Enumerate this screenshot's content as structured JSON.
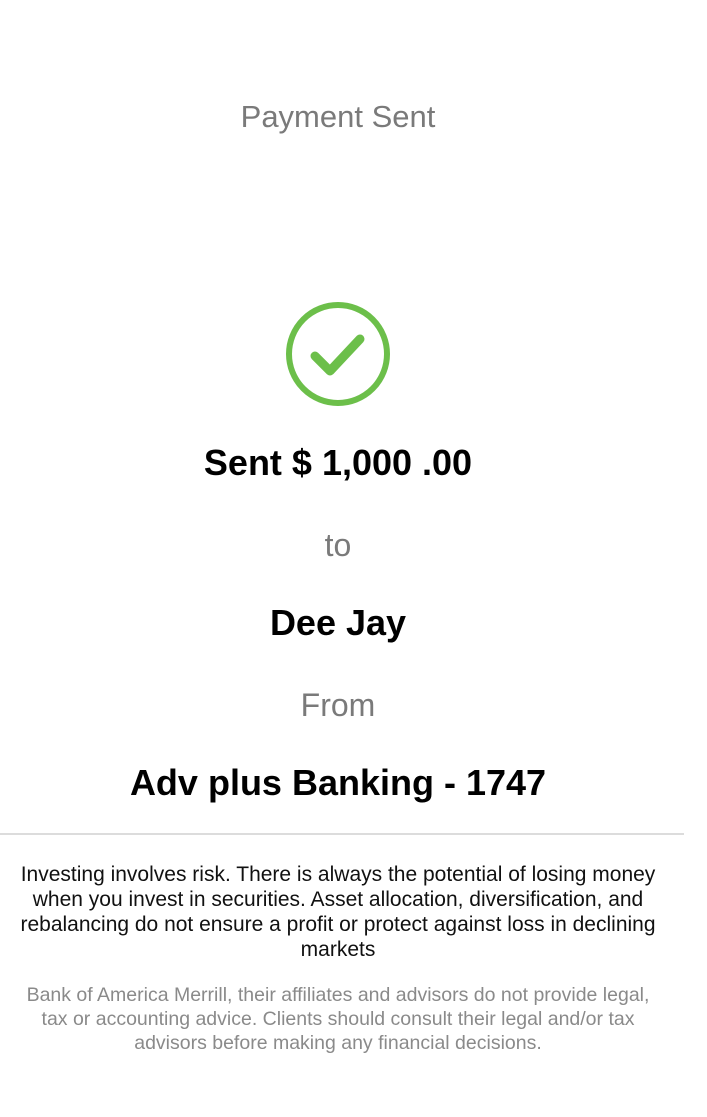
{
  "header": {
    "title": "Payment Sent"
  },
  "confirmation": {
    "icon": "check-circle-icon",
    "icon_color": "#6cbf4a",
    "amount_text": "Sent $ 1,000 .00",
    "to_label": "to",
    "recipient_name": "Dee Jay",
    "from_label": "From",
    "account_name": "Adv plus Banking - 1747"
  },
  "disclaimers": {
    "investing_risk": "Investing involves risk. There is always the potential of losing money when you invest in securities. Asset allocation, diversification, and rebalancing do not ensure a profit or protect against loss in declining markets",
    "advice_notice": "Bank of America Merrill, their affiliates and advisors do not provide legal, tax or accounting advice. Clients should consult their legal and/or tax advisors before making any financial decisions."
  }
}
